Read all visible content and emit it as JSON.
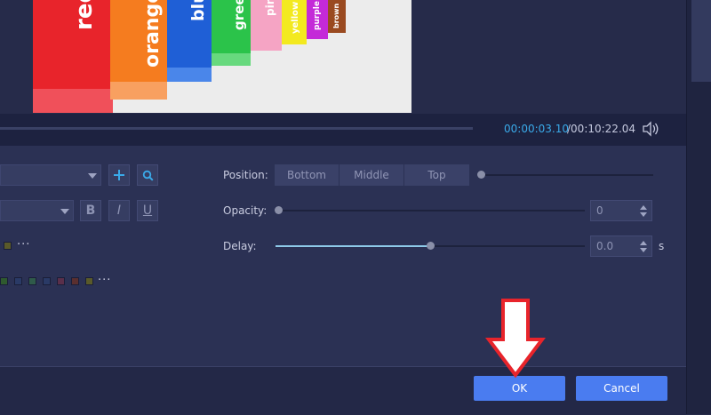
{
  "player": {
    "time_current": "00:00:03.10",
    "time_total": "/00:10:22.04"
  },
  "preview": {
    "bottle_labels": [
      "red",
      "orange",
      "blue",
      "green",
      "pink",
      "yellow",
      "purple",
      "brown"
    ]
  },
  "text_style": {
    "bold_label": "B",
    "italic_label": "I",
    "underline_label": "U",
    "more_label": "···",
    "swatch_colors_row1": [
      "#5a5a2a"
    ],
    "swatch_colors_row2": [
      "#2f5a2f",
      "#2a3a66",
      "#2f5a4a",
      "#5a2f4a",
      "#5a2f2f",
      "#5a5a2a"
    ]
  },
  "position": {
    "label": "Position:",
    "options": [
      "Bottom",
      "Middle",
      "Top"
    ]
  },
  "opacity": {
    "label": "Opacity:",
    "value": "0"
  },
  "delay": {
    "label": "Delay:",
    "value": "0.0",
    "unit": "s",
    "level": 0.5
  },
  "footer": {
    "ok_label": "OK",
    "cancel_label": "Cancel"
  },
  "colors": {
    "accent": "#4a7cf0",
    "time_highlight": "#3aaae9",
    "annotation_arrow": "#e8242b"
  }
}
